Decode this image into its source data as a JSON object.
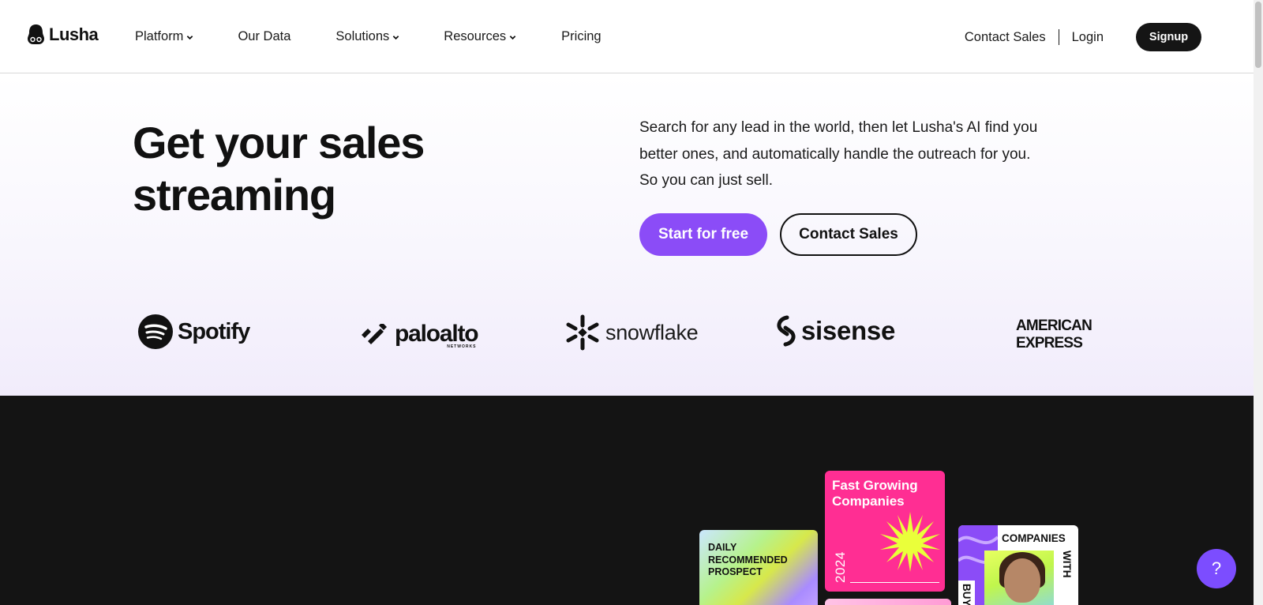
{
  "brand": {
    "name": "Lusha",
    "accent": "#8b4cf7"
  },
  "nav": {
    "items": [
      {
        "label": "Platform",
        "has_dropdown": true
      },
      {
        "label": "Our Data",
        "has_dropdown": false
      },
      {
        "label": "Solutions",
        "has_dropdown": true
      },
      {
        "label": "Resources",
        "has_dropdown": true
      },
      {
        "label": "Pricing",
        "has_dropdown": false
      }
    ]
  },
  "header": {
    "contact_sales": "Contact Sales",
    "login": "Login",
    "signup": "Signup"
  },
  "hero": {
    "title": "Get your sales streaming",
    "description": "Search for any lead in the world, then let Lusha's AI find you better ones, and automatically handle the outreach for you. So you can just sell.",
    "primary_cta": "Start for free",
    "secondary_cta": "Contact Sales"
  },
  "customer_logos": {
    "spotify": "Spotify",
    "paloalto": "paloalto",
    "paloalto_sub": "NETWORKS",
    "snowflake": "snowflake",
    "sisense": "sisense",
    "amex_line1": "AMERICAN",
    "amex_line2": "EXPRESS"
  },
  "cards": {
    "daily": "DAILY RECOMMENDED PROSPECT",
    "fast_growing": "Fast Growing Companies",
    "fast_year": "2024",
    "buying_top": "COMPANIES",
    "buying_right": "WITH",
    "buying_left": "BUYI"
  },
  "help": {
    "label": "?"
  }
}
